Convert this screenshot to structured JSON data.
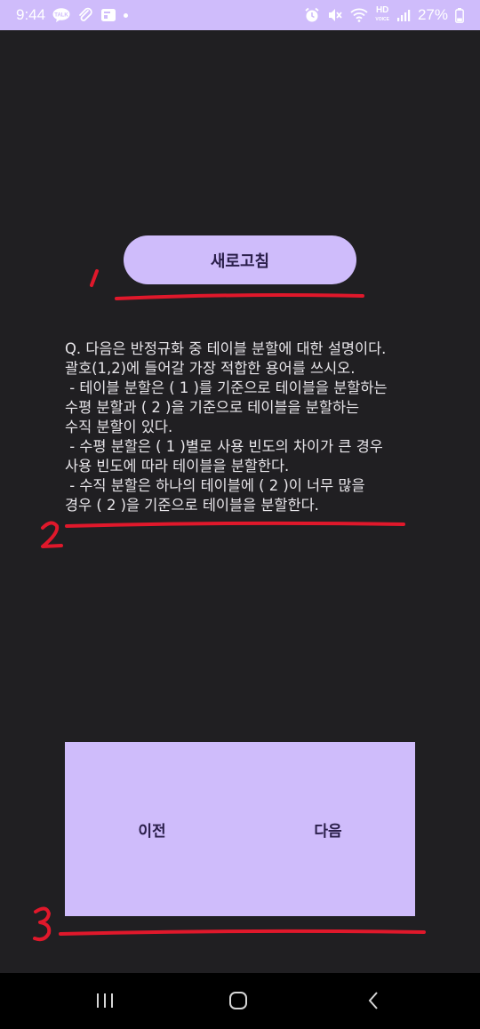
{
  "status_bar": {
    "time": "9:44",
    "talk_badge": "TALK",
    "hd_label": "HD",
    "hd_sub": "VOICE",
    "battery_percent": "27%",
    "icons": [
      "kakaotalk-icon",
      "paperclip-icon",
      "photo-icon",
      "notification-dot-icon",
      "alarm-icon",
      "mute-icon",
      "wifi-icon",
      "hd-voice-icon",
      "signal-icon",
      "battery-icon"
    ]
  },
  "main": {
    "refresh_label": "새로고침",
    "question_lines": [
      "Q. 다음은 반정규화 중 테이블 분할에 대한 설명이다.",
      "괄호(1,2)에 들어갈 가장 적합한 용어를 쓰시오.",
      " - 테이블 분할은 ( 1 )를 기준으로 테이블을 분할하는",
      "수평 분할과 ( 2 )을 기준으로 테이블을 분할하는",
      "수직 분할이 있다.",
      " - 수평 분할은 ( 1 )별로 사용 빈도의 차이가 큰 경우",
      "사용 빈도에 따라 테이블을 분할한다.",
      " - 수직 분할은 하나의 테이블에 ( 2 )이 너무 많을",
      "경우 ( 2 )을 기준으로 테이블을 분할한다."
    ],
    "prev_label": "이전",
    "next_label": "다음"
  },
  "colors": {
    "accent": "#cfbcfb",
    "background": "#201f22",
    "annotation_red": "#e0182b",
    "button_text": "#2a1e4a"
  }
}
